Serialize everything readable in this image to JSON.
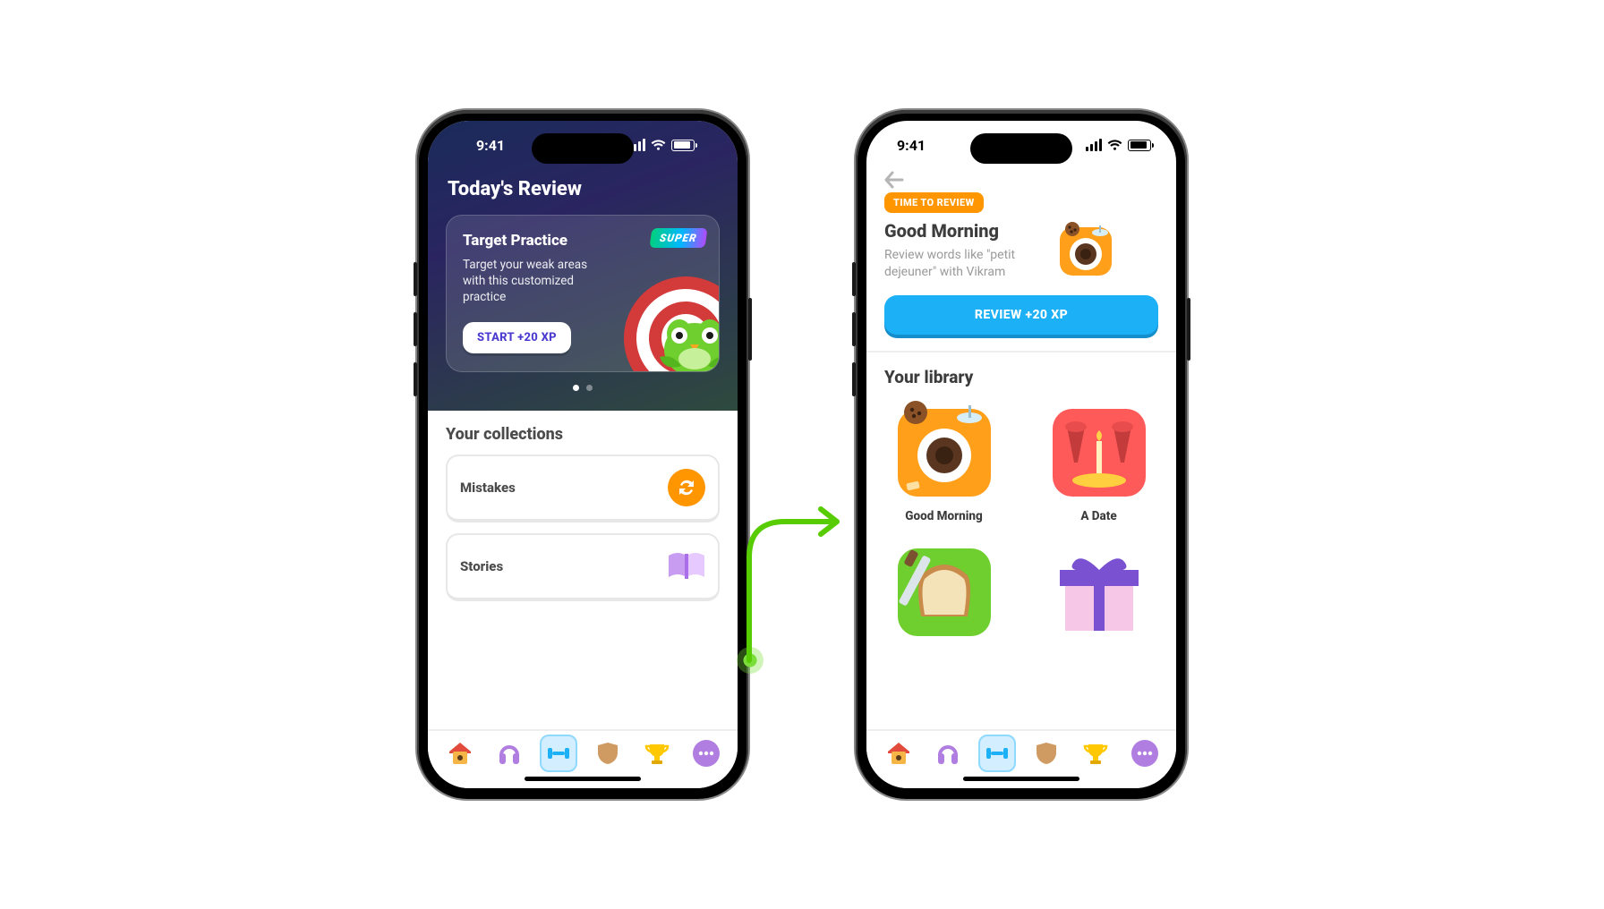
{
  "status_time": "9:41",
  "left": {
    "hero_title": "Today's Review",
    "card_title": "Target Practice",
    "card_body": "Target your weak areas with this customized practice",
    "start_label": "START +20 XP",
    "super_label": "SUPER",
    "collections_title": "Your collections",
    "rows": [
      {
        "label": "Mistakes"
      },
      {
        "label": "Stories"
      }
    ]
  },
  "right": {
    "badge": "TIME TO REVIEW",
    "title": "Good Morning",
    "body": "Review words like \"petit dejeuner\" with Vikram",
    "review_label": "REVIEW +20 XP",
    "library_title": "Your library",
    "tiles": [
      {
        "label": "Good Morning"
      },
      {
        "label": "A Date"
      },
      {
        "label": ""
      },
      {
        "label": ""
      }
    ]
  },
  "tabs": [
    "home",
    "listen",
    "practice",
    "shield",
    "trophy",
    "more"
  ]
}
